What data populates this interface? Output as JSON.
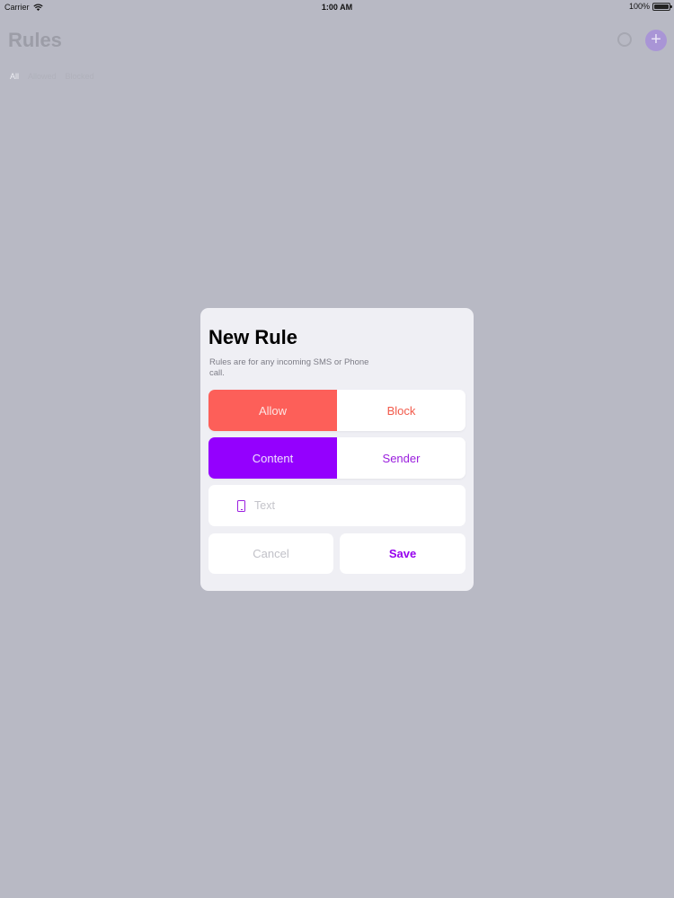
{
  "status_bar": {
    "carrier": "Carrier",
    "time": "1:00 AM",
    "battery": "100%",
    "battery_level": 1.0
  },
  "background": {
    "title": "Rules",
    "filters": [
      "All",
      "Allowed",
      "Blocked"
    ]
  },
  "modal": {
    "title": "New Rule",
    "subtitle": "Rules are for any incoming SMS or Phone call.",
    "rule_type": {
      "options": [
        "Allow",
        "Block"
      ],
      "selected": "Allow",
      "active_color": "#fd5f59"
    },
    "match_target": {
      "options": [
        "Content",
        "Sender"
      ],
      "selected": "Content",
      "active_color": "#9400fe"
    },
    "text_field": {
      "icon": "phone-icon",
      "placeholder": "Text",
      "value": ""
    },
    "cancel_label": "Cancel",
    "save_label": "Save"
  },
  "colors": {
    "accent": "#9400fe",
    "allow": "#fd5f59",
    "overlay": "#b8b9c4"
  }
}
